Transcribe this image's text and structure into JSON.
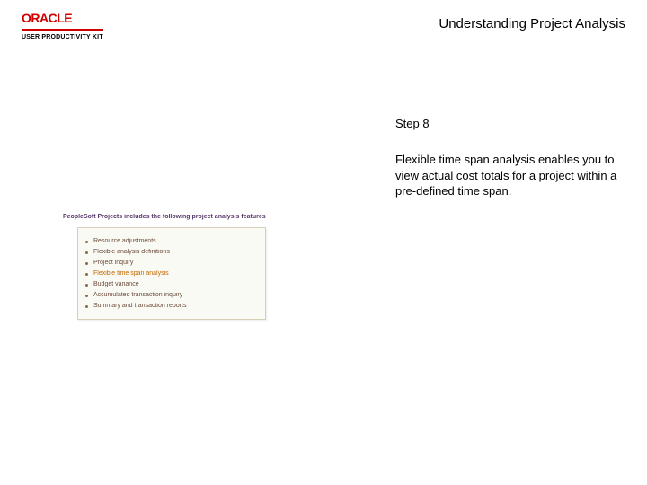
{
  "header": {
    "logo_text": "ORACLE",
    "logo_subtitle": "USER PRODUCTIVITY KIT",
    "page_title": "Understanding Project Analysis"
  },
  "step": {
    "label": "Step 8",
    "body": "Flexible time span analysis enables you to view actual cost totals for a project within a pre-defined time span."
  },
  "slide": {
    "heading": "PeopleSoft Projects includes the following project analysis features",
    "items": [
      {
        "text": "Resource adjustments",
        "highlight": false
      },
      {
        "text": "Flexible analysis definitions",
        "highlight": false
      },
      {
        "text": "Project inquiry",
        "highlight": false
      },
      {
        "text": "Flexible time span analysis",
        "highlight": true
      },
      {
        "text": "Budget variance",
        "highlight": false
      },
      {
        "text": "Accumulated transaction inquiry",
        "highlight": false
      },
      {
        "text": "Summary and transaction reports",
        "highlight": false
      }
    ]
  }
}
